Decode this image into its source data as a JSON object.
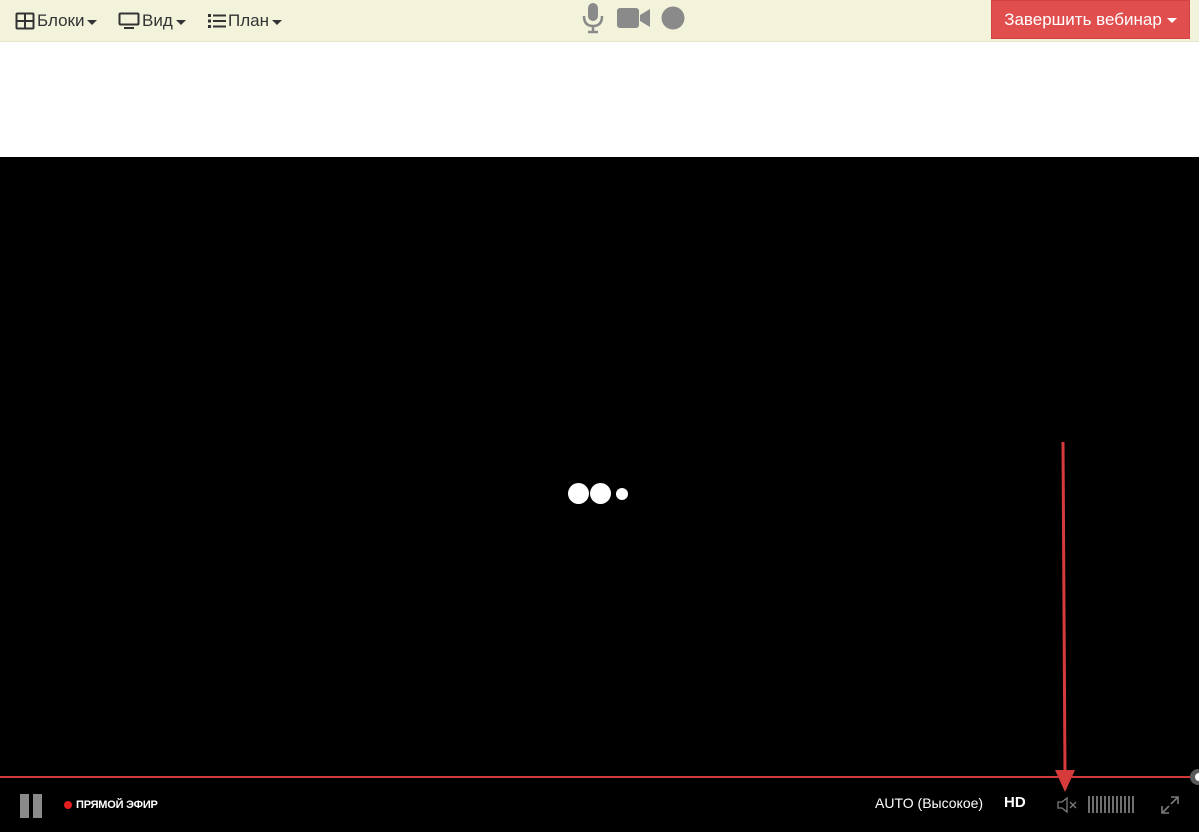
{
  "toolbar": {
    "menus": [
      {
        "label": "Блоки",
        "icon": "grid-icon"
      },
      {
        "label": "Вид",
        "icon": "monitor-icon"
      },
      {
        "label": "План",
        "icon": "list-icon"
      }
    ],
    "media_controls": [
      {
        "icon": "microphone-icon"
      },
      {
        "icon": "camera-icon"
      },
      {
        "icon": "record-icon"
      }
    ],
    "end_webinar_label": "Завершить вебинар"
  },
  "player": {
    "live_label": "ПРЯМОЙ ЭФИР",
    "quality_label": "AUTO (Высокое)",
    "hd_label": "HD",
    "volume_level": 0
  },
  "colors": {
    "toolbar_bg": "#f3f3dc",
    "end_button_bg": "#e14e4e",
    "player_bg": "#000000",
    "progress_line": "#d23a3a",
    "live_dot": "#e31e1e",
    "annotation_arrow": "#d63b3b"
  }
}
